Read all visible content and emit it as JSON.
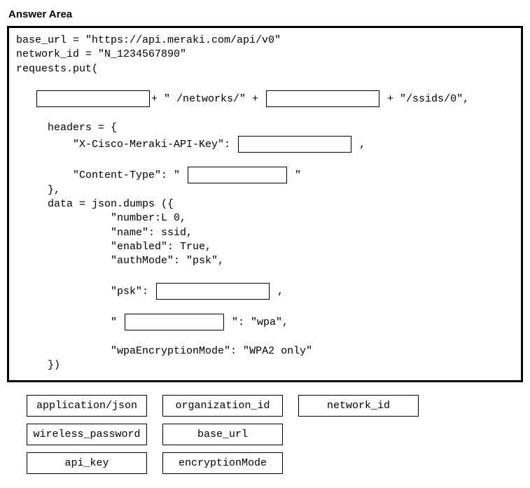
{
  "title": "Answer Area",
  "code": {
    "line1": "base_url = \"https://api.meraki.com/api/v0\"",
    "line2": "network_id = \"N_1234567890\"",
    "line3": "requests.put(",
    "seg1": "+ \" /networks/\" + ",
    "seg2": " + \"/ssids/0\",",
    "headers_open": "headers = {",
    "header_key1": "\"X-Cisco-Meraki-API-Key\": ",
    "comma": " ,",
    "header_key2a": "\"Content-Type\": \" ",
    "header_key2b": " \"",
    "headers_close": "},",
    "data_open": "data = json.dumps ({",
    "d1": "\"number:L 0,",
    "d2": "\"name\": ssid,",
    "d3": "\"enabled\": True,",
    "d4": "\"authMode\": \"psk\",",
    "psk_a": "\"psk\": ",
    "psk_b": " ,",
    "enc_a": "\" ",
    "enc_b": " \": \"wpa\",",
    "d5": "\"wpaEncryptionMode\": \"WPA2 only\"",
    "data_close": "})"
  },
  "options": {
    "row1": [
      "application/json",
      "organization_id",
      "network_id"
    ],
    "row2": [
      "wireless_password",
      "base_url"
    ],
    "row3": [
      "api_key",
      "encryptionMode"
    ]
  }
}
